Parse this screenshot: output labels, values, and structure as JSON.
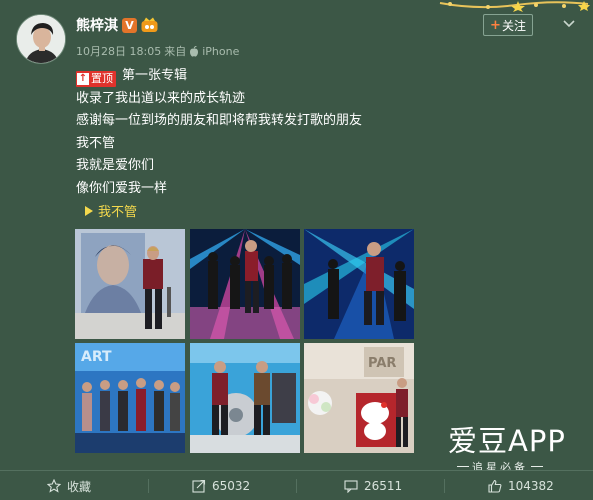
{
  "post": {
    "author": "熊梓淇",
    "verified_badge": "V",
    "time": "10月28日 18:05",
    "source_prefix": "来自",
    "source": "iPhone",
    "follow_label": "关注",
    "pin_tag": "置顶",
    "lines": [
      "第一张专辑",
      "收录了我出道以来的成长轨迹",
      "感谢每一位到场的朋友和即将帮我转发打歌的朋友",
      "我不管",
      "我就是爱你们",
      "像你们爱我一样"
    ],
    "music_link": "我不管"
  },
  "watermark": {
    "title": "爱豆APP",
    "subtitle": "追星必备"
  },
  "actions": {
    "favorite": "收藏",
    "repost": "65032",
    "comment": "26511",
    "like": "104382"
  },
  "colors": {
    "background": "#3c5746",
    "accent_orange": "#ff8140",
    "link_yellow": "#f4d94d",
    "pin_red": "#e0322c"
  }
}
